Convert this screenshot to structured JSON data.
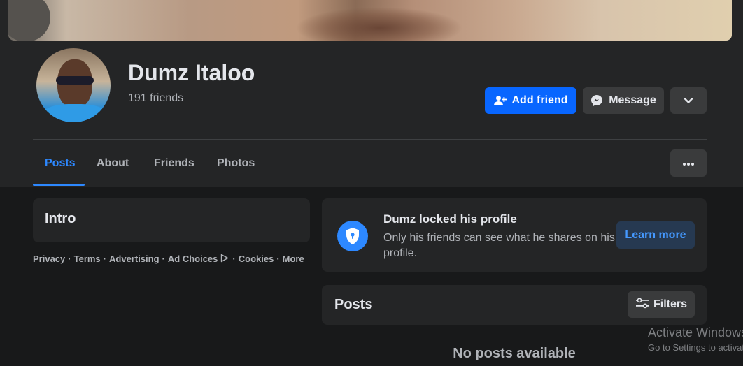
{
  "profile": {
    "name": "Dumz Italoo",
    "friends_count": "191 friends"
  },
  "actions": {
    "add_friend": "Add friend",
    "message": "Message"
  },
  "tabs": [
    {
      "label": "Posts",
      "active": true
    },
    {
      "label": "About",
      "active": false
    },
    {
      "label": "Friends",
      "active": false
    },
    {
      "label": "Photos",
      "active": false
    }
  ],
  "intro": {
    "title": "Intro"
  },
  "footer_links": [
    "Privacy",
    "Terms",
    "Advertising",
    "Ad Choices",
    "Cookies",
    "More"
  ],
  "locked_notice": {
    "title": "Dumz locked his profile",
    "description": "Only his friends can see what he shares on his profile.",
    "learn_more": "Learn more"
  },
  "posts": {
    "title": "Posts",
    "filters_label": "Filters",
    "empty_text": "No posts available"
  },
  "watermark": {
    "line1": "Activate Windows",
    "line2": "Go to Settings to activate Windows."
  },
  "colors": {
    "accent": "#0866ff",
    "link": "#2d88ff",
    "surface": "#242526",
    "background": "#18191a"
  },
  "icons": [
    "add-friend-icon",
    "messenger-icon",
    "chevron-down-icon",
    "more-dots-icon",
    "ad-choices-icon",
    "shield-lock-icon",
    "filters-icon"
  ]
}
